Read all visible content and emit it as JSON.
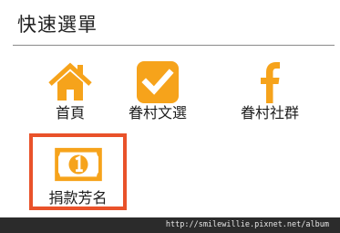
{
  "menu": {
    "title": "快速選單",
    "items": [
      {
        "label": "首頁",
        "icon": "home-icon"
      },
      {
        "label": "眷村文選",
        "icon": "checkbox-icon"
      },
      {
        "label": "眷村社群",
        "icon": "facebook-icon"
      },
      {
        "label": "捐款芳名",
        "icon": "banknote-icon",
        "selected": true
      }
    ]
  },
  "footer": {
    "url": "http://smilewillie.pixnet.net/album"
  },
  "colors": {
    "icon": "#f6a31b",
    "selected_border": "#e9522a",
    "footer_bg": "#2b2b2b"
  }
}
